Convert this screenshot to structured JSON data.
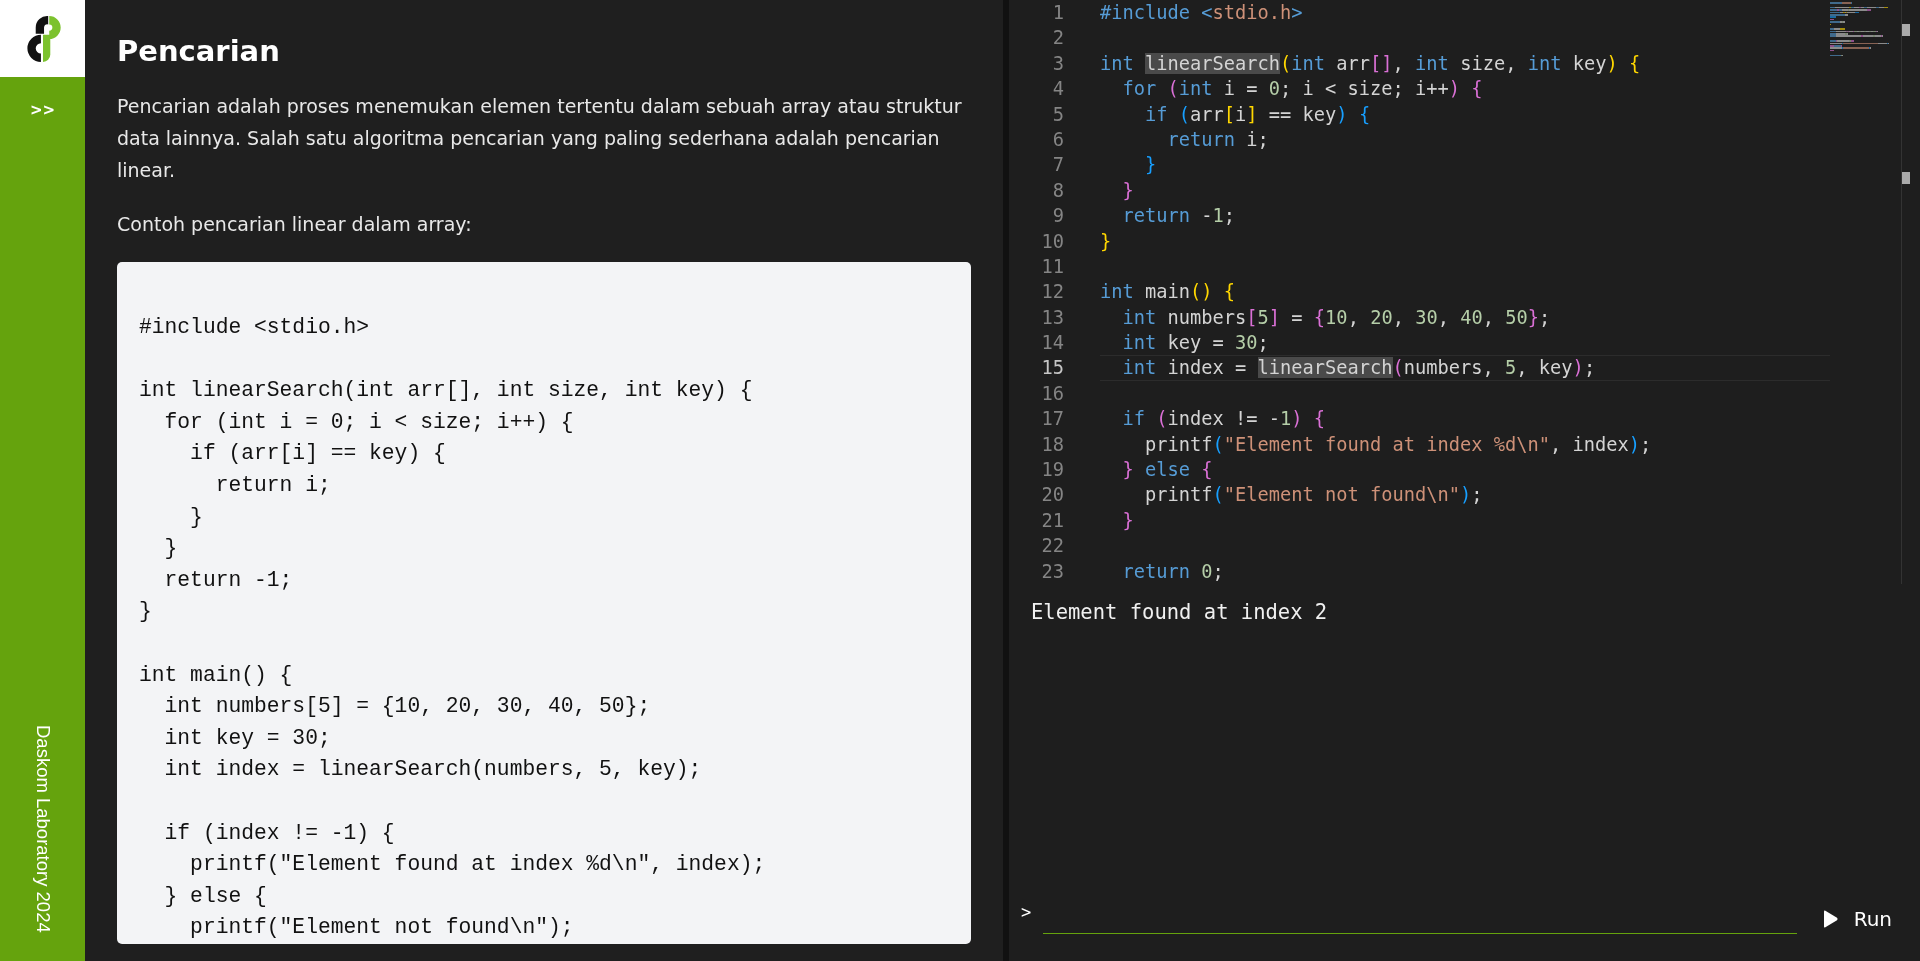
{
  "sidebar": {
    "toggle": ">>",
    "footer": "Daskom Laboratory 2024"
  },
  "lesson": {
    "title": "Pencarian",
    "paragraphs": [
      "Pencarian adalah proses menemukan elemen tertentu dalam sebuah array atau struktur data lainnya. Salah satu algoritma pencarian yang paling sederhana adalah pencarian linear.",
      "Contoh pencarian linear dalam array:"
    ],
    "code": "#include <stdio.h>\n\nint linearSearch(int arr[], int size, int key) {\n  for (int i = 0; i < size; i++) {\n    if (arr[i] == key) {\n      return i;\n    }\n  }\n  return -1;\n}\n\nint main() {\n  int numbers[5] = {10, 20, 30, 40, 50};\n  int key = 30;\n  int index = linearSearch(numbers, 5, key);\n\n  if (index != -1) {\n    printf(\"Element found at index %d\\n\", index);\n  } else {\n    printf(\"Element not found\\n\");"
  },
  "editor": {
    "lines": [
      {
        "number": "1",
        "current": false,
        "tokens": [
          {
            "text": "#include ",
            "kind": "kw"
          },
          {
            "text": "<",
            "kind": "kw"
          },
          {
            "text": "stdio.h",
            "kind": "str"
          },
          {
            "text": ">",
            "kind": "kw"
          }
        ]
      },
      {
        "number": "2",
        "current": false
      },
      {
        "number": "3",
        "current": false,
        "tokens": [
          {
            "text": "int ",
            "kind": "kw"
          },
          {
            "text": "linearSearch",
            "kind": "match"
          },
          {
            "text": "(",
            "kind": "b1"
          },
          {
            "text": "int",
            "kind": "kw"
          },
          {
            "text": " arr",
            "kind": "plain"
          },
          {
            "text": "[]",
            "kind": "b2"
          },
          {
            "text": ", ",
            "kind": "plain"
          },
          {
            "text": "int",
            "kind": "kw"
          },
          {
            "text": " size, ",
            "kind": "plain"
          },
          {
            "text": "int",
            "kind": "kw"
          },
          {
            "text": " key",
            "kind": "plain"
          },
          {
            "text": ")",
            "kind": "b1"
          },
          {
            "text": " {",
            "kind": "b1"
          }
        ]
      },
      {
        "number": "4",
        "current": false,
        "tokens": [
          {
            "text": "  for ",
            "kind": "kw"
          },
          {
            "text": "(",
            "kind": "b2"
          },
          {
            "text": "int",
            "kind": "kw"
          },
          {
            "text": " i = ",
            "kind": "plain"
          },
          {
            "text": "0",
            "kind": "num"
          },
          {
            "text": "; i < size; i++",
            "kind": "plain"
          },
          {
            "text": ")",
            "kind": "b2"
          },
          {
            "text": " {",
            "kind": "b2"
          }
        ]
      },
      {
        "number": "5",
        "current": false,
        "tokens": [
          {
            "text": "    if ",
            "kind": "kw"
          },
          {
            "text": "(",
            "kind": "b3"
          },
          {
            "text": "arr",
            "kind": "plain"
          },
          {
            "text": "[",
            "kind": "b1"
          },
          {
            "text": "i",
            "kind": "plain"
          },
          {
            "text": "]",
            "kind": "b1"
          },
          {
            "text": " == key",
            "kind": "plain"
          },
          {
            "text": ")",
            "kind": "b3"
          },
          {
            "text": " {",
            "kind": "b3"
          }
        ]
      },
      {
        "number": "6",
        "current": false,
        "tokens": [
          {
            "text": "      return",
            "kind": "kw"
          },
          {
            "text": " i;",
            "kind": "plain"
          }
        ]
      },
      {
        "number": "7",
        "current": false,
        "tokens": [
          {
            "text": "    }",
            "kind": "b3"
          }
        ]
      },
      {
        "number": "8",
        "current": false,
        "tokens": [
          {
            "text": "  }",
            "kind": "b2"
          }
        ]
      },
      {
        "number": "9",
        "current": false,
        "tokens": [
          {
            "text": "  return",
            "kind": "kw"
          },
          {
            "text": " -",
            "kind": "plain"
          },
          {
            "text": "1",
            "kind": "num"
          },
          {
            "text": ";",
            "kind": "plain"
          }
        ]
      },
      {
        "number": "10",
        "current": false,
        "tokens": [
          {
            "text": "}",
            "kind": "b1"
          }
        ]
      },
      {
        "number": "11",
        "current": false
      },
      {
        "number": "12",
        "current": false,
        "tokens": [
          {
            "text": "int",
            "kind": "kw"
          },
          {
            "text": " main",
            "kind": "plain"
          },
          {
            "text": "()",
            "kind": "b1"
          },
          {
            "text": " {",
            "kind": "b1"
          }
        ]
      },
      {
        "number": "13",
        "current": false,
        "tokens": [
          {
            "text": "  int",
            "kind": "kw"
          },
          {
            "text": " numbers",
            "kind": "plain"
          },
          {
            "text": "[",
            "kind": "b2"
          },
          {
            "text": "5",
            "kind": "num"
          },
          {
            "text": "]",
            "kind": "b2"
          },
          {
            "text": " = ",
            "kind": "plain"
          },
          {
            "text": "{",
            "kind": "b2"
          },
          {
            "text": "10",
            "kind": "num"
          },
          {
            "text": ", ",
            "kind": "plain"
          },
          {
            "text": "20",
            "kind": "num"
          },
          {
            "text": ", ",
            "kind": "plain"
          },
          {
            "text": "30",
            "kind": "num"
          },
          {
            "text": ", ",
            "kind": "plain"
          },
          {
            "text": "40",
            "kind": "num"
          },
          {
            "text": ", ",
            "kind": "plain"
          },
          {
            "text": "50",
            "kind": "num"
          },
          {
            "text": "}",
            "kind": "b2"
          },
          {
            "text": ";",
            "kind": "plain"
          }
        ]
      },
      {
        "number": "14",
        "current": false,
        "tokens": [
          {
            "text": "  int",
            "kind": "kw"
          },
          {
            "text": " key = ",
            "kind": "plain"
          },
          {
            "text": "30",
            "kind": "num"
          },
          {
            "text": ";",
            "kind": "plain"
          }
        ]
      },
      {
        "number": "15",
        "current": true,
        "tokens": [
          {
            "text": "  int",
            "kind": "kw"
          },
          {
            "text": " index = ",
            "kind": "plain"
          },
          {
            "text": "linearSearch",
            "kind": "match"
          },
          {
            "text": "(",
            "kind": "b2"
          },
          {
            "text": "numbers, ",
            "kind": "plain"
          },
          {
            "text": "5",
            "kind": "num"
          },
          {
            "text": ", key",
            "kind": "plain"
          },
          {
            "text": ")",
            "kind": "b2"
          },
          {
            "text": ";",
            "kind": "plain"
          }
        ]
      },
      {
        "number": "16",
        "current": false
      },
      {
        "number": "17",
        "current": false,
        "tokens": [
          {
            "text": "  if ",
            "kind": "kw"
          },
          {
            "text": "(",
            "kind": "b2"
          },
          {
            "text": "index != -",
            "kind": "plain"
          },
          {
            "text": "1",
            "kind": "num"
          },
          {
            "text": ")",
            "kind": "b2"
          },
          {
            "text": " {",
            "kind": "b2"
          }
        ]
      },
      {
        "number": "18",
        "current": false,
        "tokens": [
          {
            "text": "    printf",
            "kind": "plain"
          },
          {
            "text": "(",
            "kind": "b3"
          },
          {
            "text": "\"Element found at index %d\\n\"",
            "kind": "str"
          },
          {
            "text": ", index",
            "kind": "plain"
          },
          {
            "text": ")",
            "kind": "b3"
          },
          {
            "text": ";",
            "kind": "plain"
          }
        ]
      },
      {
        "number": "19",
        "current": false,
        "tokens": [
          {
            "text": "  }",
            "kind": "b2"
          },
          {
            "text": " else ",
            "kind": "kw"
          },
          {
            "text": "{",
            "kind": "b2"
          }
        ]
      },
      {
        "number": "20",
        "current": false,
        "tokens": [
          {
            "text": "    printf",
            "kind": "plain"
          },
          {
            "text": "(",
            "kind": "b3"
          },
          {
            "text": "\"Element not found\\n\"",
            "kind": "str"
          },
          {
            "text": ")",
            "kind": "b3"
          },
          {
            "text": ";",
            "kind": "plain"
          }
        ]
      },
      {
        "number": "21",
        "current": false,
        "tokens": [
          {
            "text": "  }",
            "kind": "b2"
          }
        ]
      },
      {
        "number": "22",
        "current": false
      },
      {
        "number": "23",
        "current": false,
        "tokens": [
          {
            "text": "  return ",
            "kind": "kw"
          },
          {
            "text": "0",
            "kind": "num"
          },
          {
            "text": ";",
            "kind": "plain"
          }
        ]
      }
    ]
  },
  "output": {
    "lines": [
      "Element found at index 2"
    ]
  },
  "console": {
    "prompt": ">",
    "run_button": "Run"
  }
}
